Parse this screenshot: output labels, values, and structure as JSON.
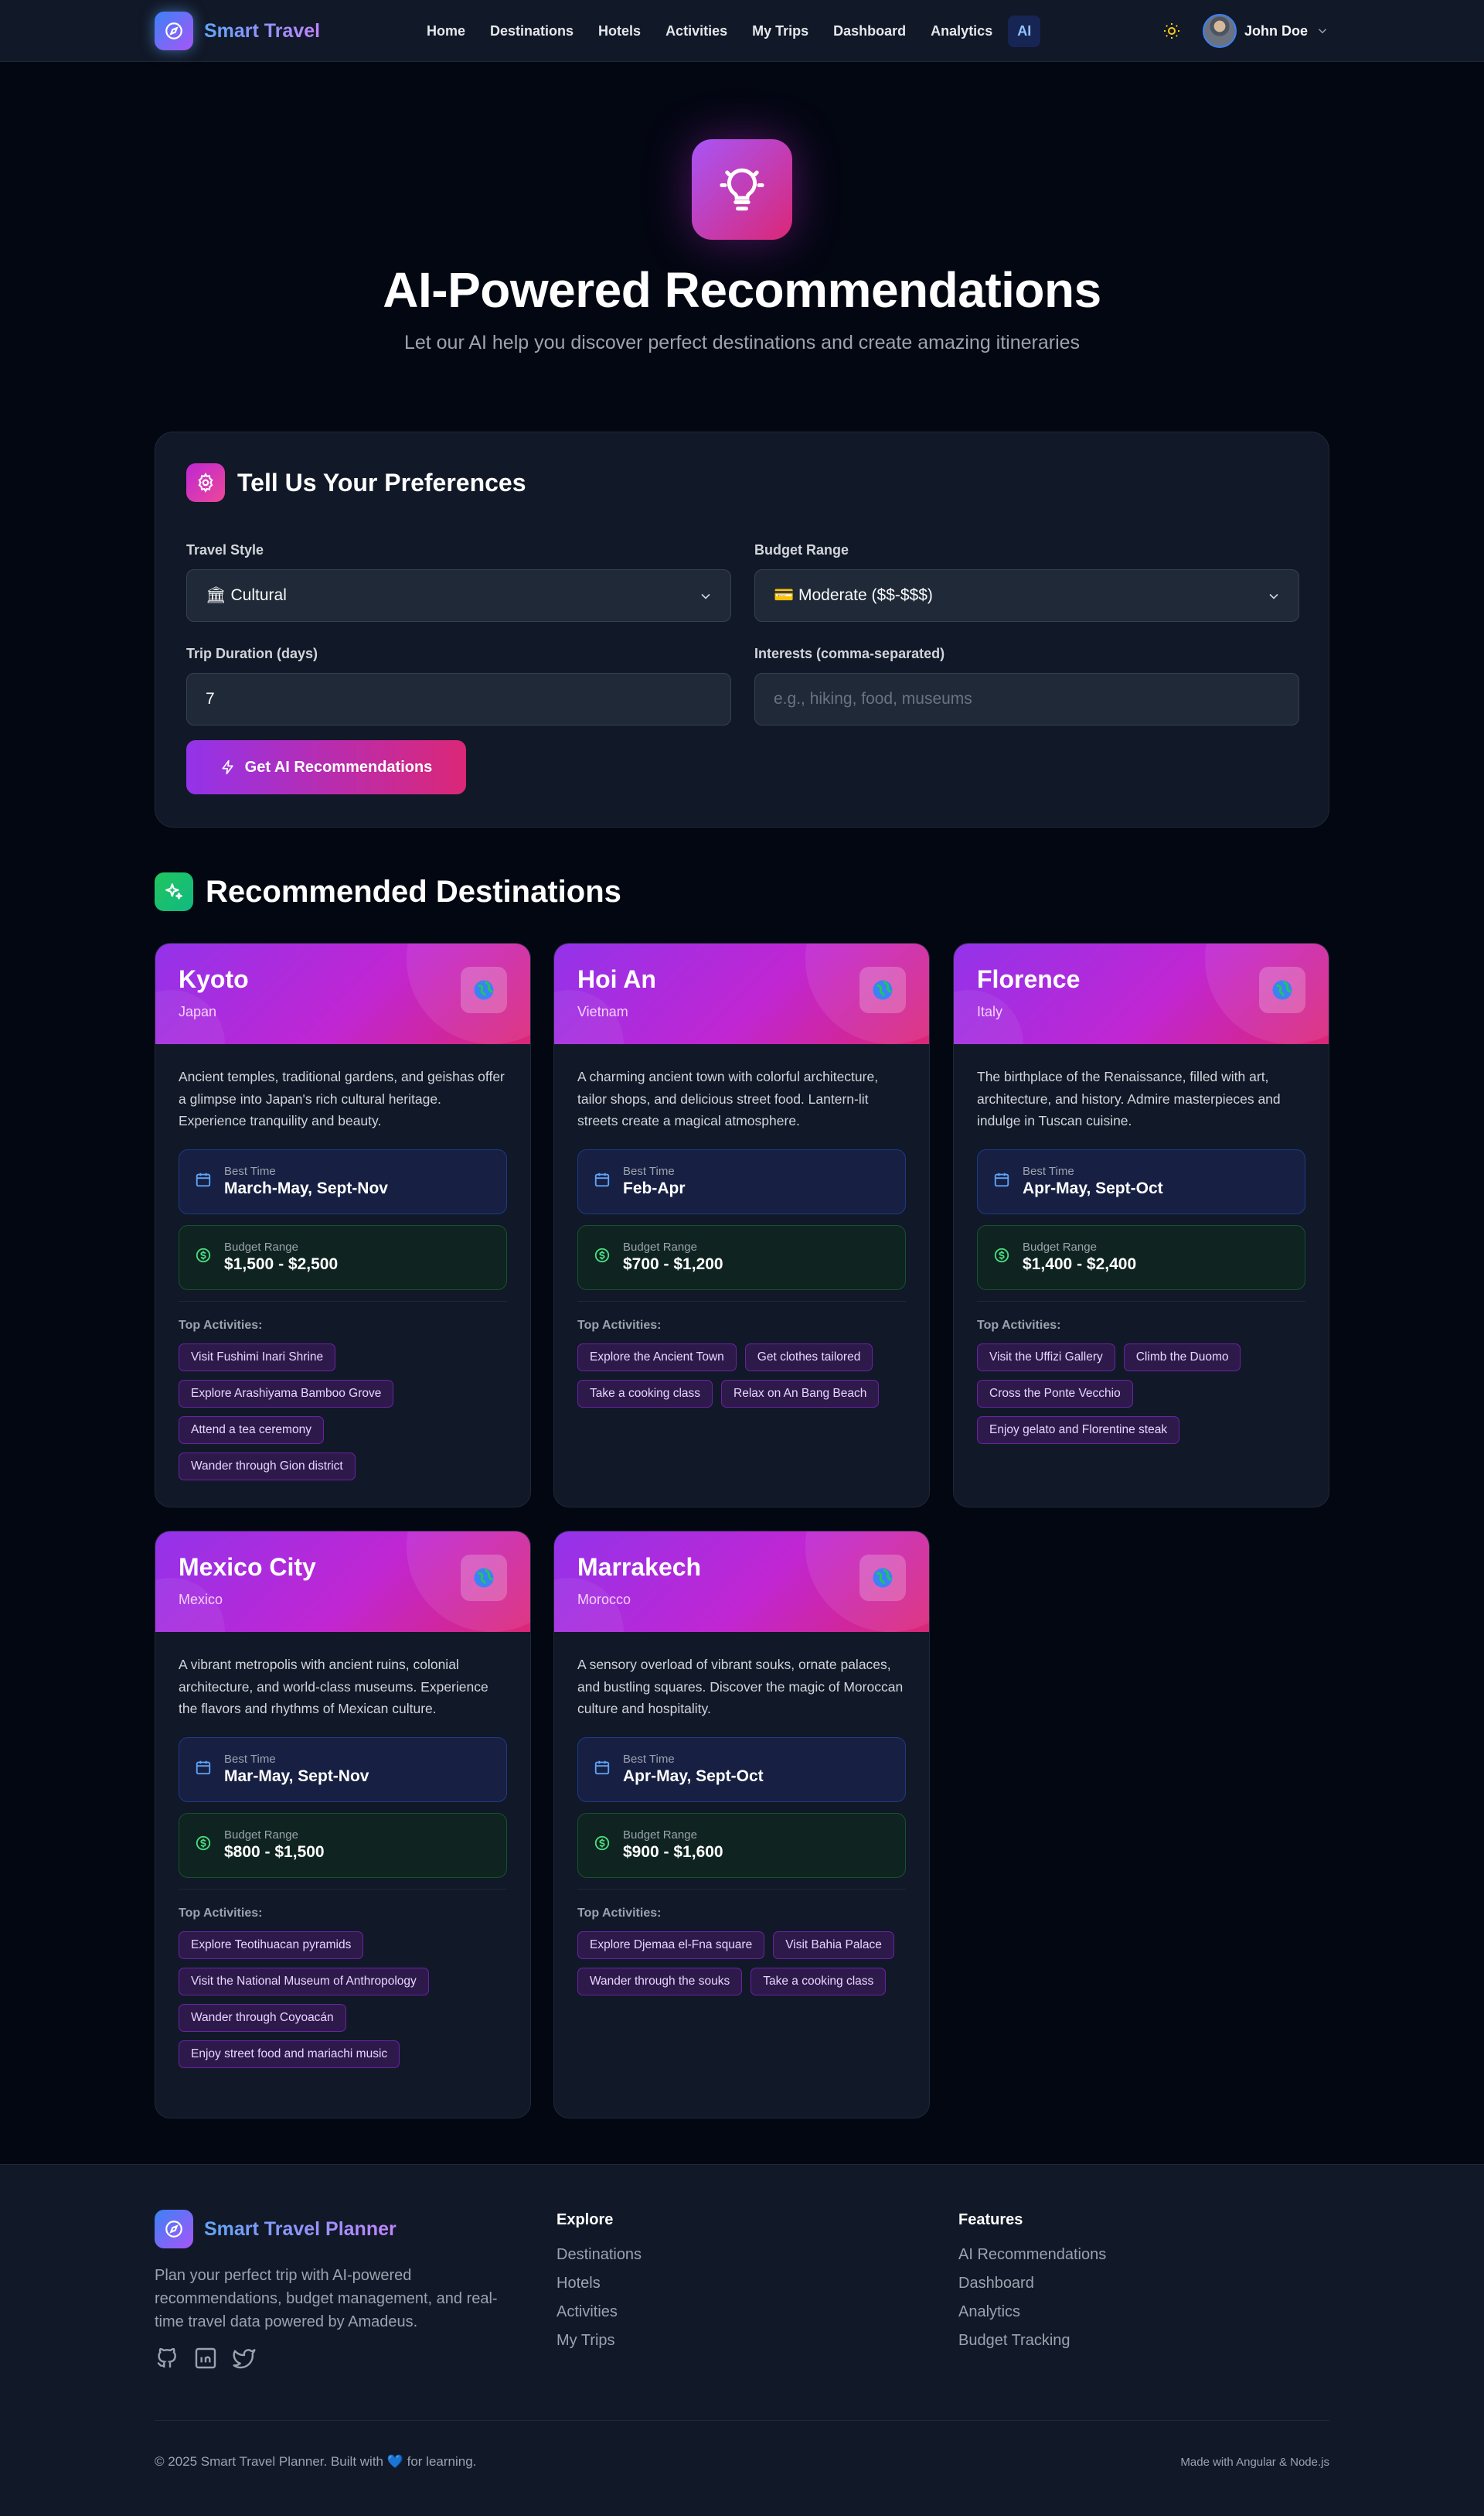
{
  "nav": {
    "brand": "Smart Travel",
    "links": [
      "Home",
      "Destinations",
      "Hotels",
      "Activities",
      "My Trips",
      "Dashboard",
      "Analytics",
      "AI"
    ],
    "active": "AI",
    "user_name": "John Doe"
  },
  "hero": {
    "title": "AI-Powered Recommendations",
    "subtitle": "Let our AI help you discover perfect destinations and create amazing itineraries"
  },
  "preferences": {
    "title": "Tell Us Your Preferences",
    "travel_style_label": "Travel Style",
    "travel_style_value": "🏛 Cultural",
    "budget_label": "Budget Range",
    "budget_value": "💳 Moderate ($$-$$$)",
    "duration_label": "Trip Duration (days)",
    "duration_value": "7",
    "interests_label": "Interests (comma-separated)",
    "interests_placeholder": "e.g., hiking, food, museums",
    "submit_label": "Get AI Recommendations"
  },
  "recommendations": {
    "title": "Recommended Destinations",
    "best_time_label": "Best Time",
    "budget_label": "Budget Range",
    "activities_label": "Top Activities:",
    "destinations": [
      {
        "name": "Kyoto",
        "country": "Japan",
        "description": "Ancient temples, traditional gardens, and geishas offer a glimpse into Japan's rich cultural heritage. Experience tranquility and beauty.",
        "best_time": "March-May, Sept-Nov",
        "budget": "$1,500 - $2,500",
        "activities": [
          "Visit Fushimi Inari Shrine",
          "Explore Arashiyama Bamboo Grove",
          "Attend a tea ceremony",
          "Wander through Gion district"
        ]
      },
      {
        "name": "Hoi An",
        "country": "Vietnam",
        "description": "A charming ancient town with colorful architecture, tailor shops, and delicious street food. Lantern-lit streets create a magical atmosphere.",
        "best_time": "Feb-Apr",
        "budget": "$700 - $1,200",
        "activities": [
          "Explore the Ancient Town",
          "Get clothes tailored",
          "Take a cooking class",
          "Relax on An Bang Beach"
        ]
      },
      {
        "name": "Florence",
        "country": "Italy",
        "description": "The birthplace of the Renaissance, filled with art, architecture, and history. Admire masterpieces and indulge in Tuscan cuisine.",
        "best_time": "Apr-May, Sept-Oct",
        "budget": "$1,400 - $2,400",
        "activities": [
          "Visit the Uffizi Gallery",
          "Climb the Duomo",
          "Cross the Ponte Vecchio",
          "Enjoy gelato and Florentine steak"
        ]
      },
      {
        "name": "Mexico City",
        "country": "Mexico",
        "description": "A vibrant metropolis with ancient ruins, colonial architecture, and world-class museums. Experience the flavors and rhythms of Mexican culture.",
        "best_time": "Mar-May, Sept-Nov",
        "budget": "$800 - $1,500",
        "activities": [
          "Explore Teotihuacan pyramids",
          "Visit the National Museum of Anthropology",
          "Wander through Coyoacán",
          "Enjoy street food and mariachi music"
        ]
      },
      {
        "name": "Marrakech",
        "country": "Morocco",
        "description": "A sensory overload of vibrant souks, ornate palaces, and bustling squares. Discover the magic of Moroccan culture and hospitality.",
        "best_time": "Apr-May, Sept-Oct",
        "budget": "$900 - $1,600",
        "activities": [
          "Explore Djemaa el-Fna square",
          "Visit Bahia Palace",
          "Wander through the souks",
          "Take a cooking class"
        ]
      }
    ]
  },
  "footer": {
    "brand": "Smart Travel Planner",
    "description": "Plan your perfect trip with AI-powered recommendations, budget management, and real-time travel data powered by Amadeus.",
    "explore_title": "Explore",
    "explore_links": [
      "Destinations",
      "Hotels",
      "Activities",
      "My Trips"
    ],
    "features_title": "Features",
    "features_links": [
      "AI Recommendations",
      "Dashboard",
      "Analytics",
      "Budget Tracking"
    ],
    "copyright": "© 2025 Smart Travel Planner. Built with 💙 for learning.",
    "made_with": "Made with Angular & Node.js"
  },
  "colors": {
    "accent_purple": "#9333ea",
    "accent_pink": "#db2777",
    "brand_blue": "#60a5fa",
    "background": "#030712"
  }
}
